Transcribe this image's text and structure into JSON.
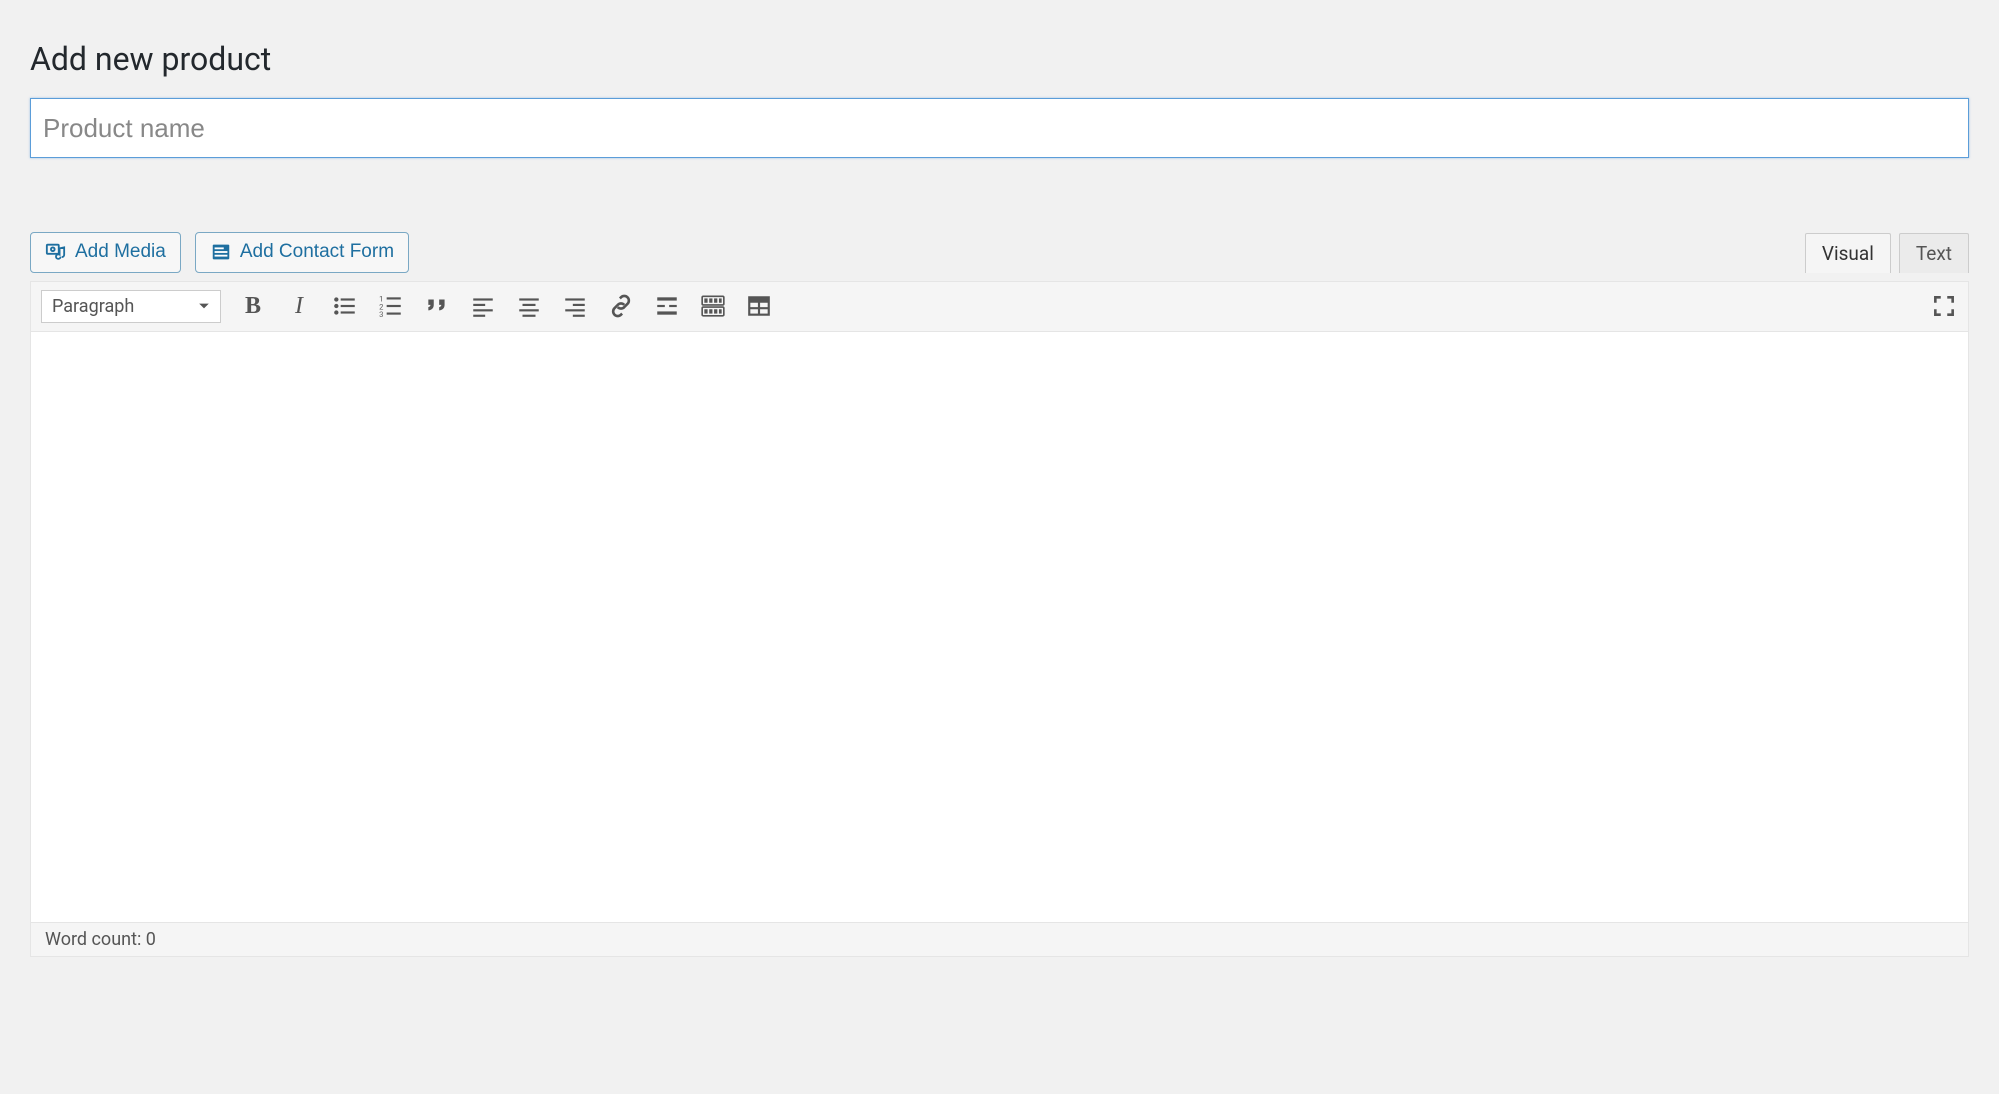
{
  "header": {
    "title": "Add new product"
  },
  "title_field": {
    "placeholder": "Product name",
    "value": ""
  },
  "media_buttons": {
    "add_media": "Add Media",
    "add_contact_form": "Add Contact Form"
  },
  "editor_tabs": {
    "visual": "Visual",
    "text": "Text",
    "active": "visual"
  },
  "format_dropdown": {
    "selected": "Paragraph"
  },
  "toolbar_buttons": {
    "bold": "B",
    "italic": "I"
  },
  "status": {
    "word_count_label": "Word count: 0"
  }
}
